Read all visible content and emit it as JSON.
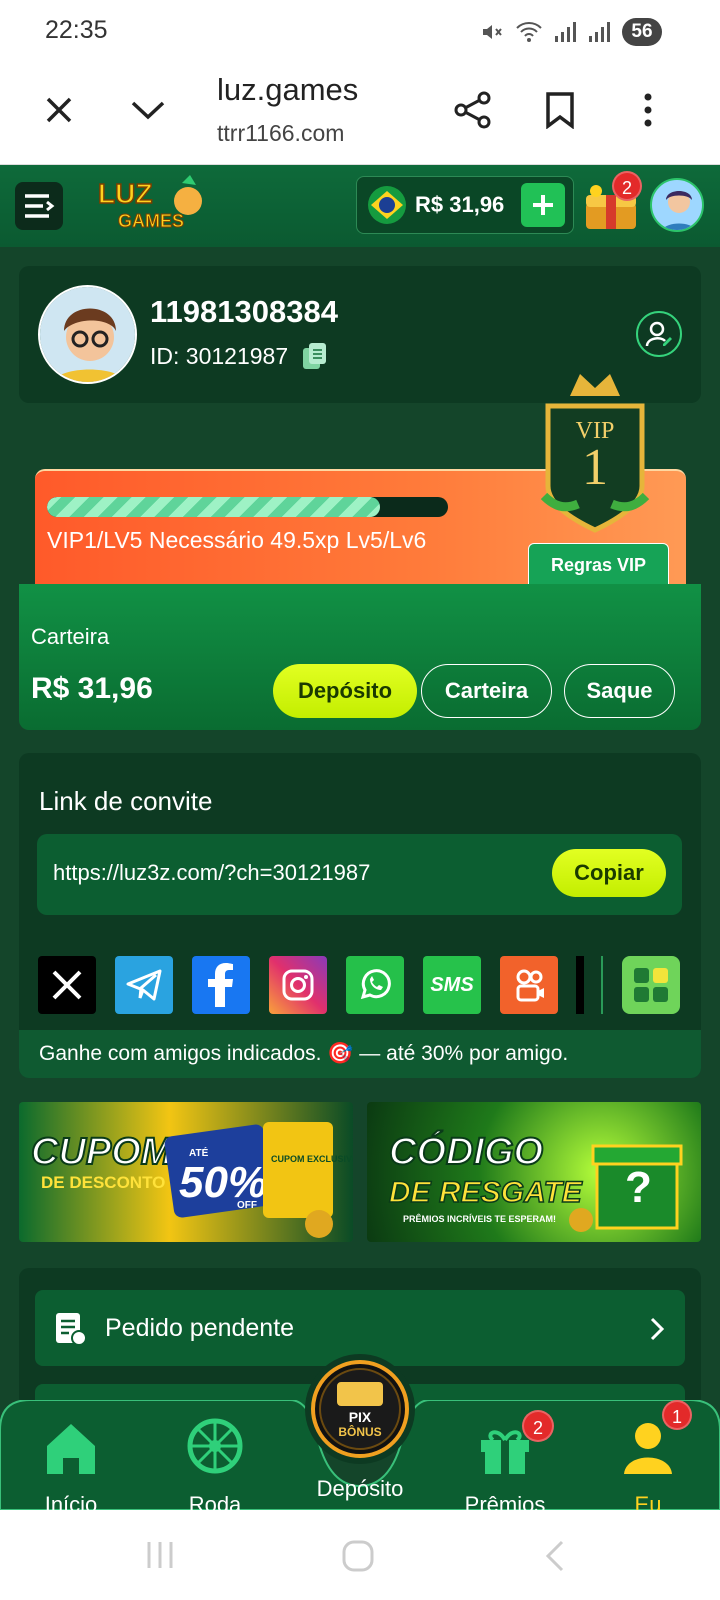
{
  "status_bar": {
    "time": "22:35",
    "battery": "56"
  },
  "browser": {
    "title": "luz.games",
    "url": "ttrr1166.com"
  },
  "header": {
    "logo_text_top": "LUZ",
    "logo_text_bottom": "GAMES",
    "balance": "R$ 31,96",
    "gift_badge": "2"
  },
  "profile": {
    "name": "11981308384",
    "id": "ID: 30121987"
  },
  "vip": {
    "badge_title": "VIP",
    "badge_level": "1",
    "progress": 0.83,
    "text": "VIP1/LV5  Necessário 49.5xp Lv5/Lv6",
    "rules_label": "Regras VIP"
  },
  "wallet": {
    "label": "Carteira",
    "amount": "R$ 31,96",
    "deposit_label": "Depósito",
    "wallet_label": "Carteira",
    "withdraw_label": "Saque"
  },
  "invite": {
    "title": "Link de convite",
    "url": "https://luz3z.com/?ch=30121987",
    "copy_label": "Copiar",
    "sms_label": "SMS",
    "footer": "Ganhe com amigos indicados. 🎯 — até 30% por amigo."
  },
  "banners": {
    "cupom": {
      "title": "CUPOM",
      "subtitle": "DE DESCONTO",
      "percent": "50%",
      "percent_prefix": "ATÉ",
      "percent_suffix": "OFF",
      "ticket": "CUPOM EXCLUSIVO"
    },
    "codigo": {
      "title": "CÓDIGO",
      "subtitle": "DE RESGATE",
      "tagline": "PRÊMIOS INCRÍVEIS TE ESPERAM!"
    }
  },
  "orders": {
    "pending_label": "Pedido pendente"
  },
  "bottom_nav": {
    "items": [
      {
        "label": "Início"
      },
      {
        "label": "Roda"
      },
      {
        "label": "Depósito"
      },
      {
        "label": "Prêmios",
        "badge": "2"
      },
      {
        "label": "Eu",
        "badge": "1"
      }
    ],
    "center_top": "PIX",
    "center_bottom": "BÔNUS"
  },
  "colors": {
    "accent_yellow": "#d4f700",
    "brand_green": "#119145",
    "active_nav": "#ffd21f"
  }
}
